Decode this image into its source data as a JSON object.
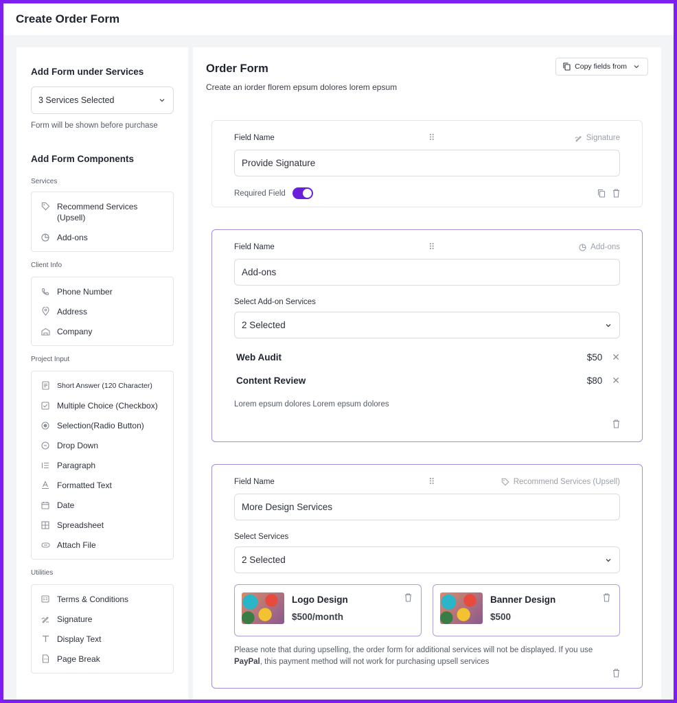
{
  "page": {
    "title": "Create Order Form"
  },
  "sidebar": {
    "add_form_title": "Add Form under Services",
    "services_select": "3 Services Selected",
    "services_hint": "Form will be shown before purchase",
    "components_title": "Add Form Components",
    "sections": [
      {
        "label": "Services",
        "items": [
          {
            "label": "Recommend Services (Upsell)",
            "icon": "tag-icon"
          },
          {
            "label": "Add-ons",
            "icon": "addons-icon"
          }
        ]
      },
      {
        "label": "Client Info",
        "items": [
          {
            "label": "Phone Number",
            "icon": "phone-icon"
          },
          {
            "label": "Address",
            "icon": "location-pin-icon"
          },
          {
            "label": "Company",
            "icon": "building-icon"
          }
        ]
      },
      {
        "label": "Project Input",
        "items": [
          {
            "label": "Short Answer (120 Character)",
            "icon": "short-answer-icon"
          },
          {
            "label": "Multiple Choice (Checkbox)",
            "icon": "checkbox-icon"
          },
          {
            "label": "Selection(Radio Button)",
            "icon": "radio-icon"
          },
          {
            "label": "Drop Down",
            "icon": "dropdown-icon"
          },
          {
            "label": "Paragraph",
            "icon": "paragraph-icon"
          },
          {
            "label": "Formatted Text",
            "icon": "formatted-text-icon"
          },
          {
            "label": "Date",
            "icon": "calendar-icon"
          },
          {
            "label": "Spreadsheet",
            "icon": "grid-icon"
          },
          {
            "label": "Attach File",
            "icon": "paperclip-icon"
          }
        ]
      },
      {
        "label": "Utilities",
        "items": [
          {
            "label": "Terms & Conditions",
            "icon": "terms-icon"
          },
          {
            "label": "Signature",
            "icon": "signature-icon"
          },
          {
            "label": "Display Text",
            "icon": "text-icon"
          },
          {
            "label": "Page Break",
            "icon": "page-break-icon"
          }
        ]
      }
    ]
  },
  "main": {
    "title": "Order Form",
    "subtitle": "Create an iorder  florem epsum dolores lorem epsum",
    "copy_button": "Copy fields from",
    "cards": {
      "signature": {
        "field_label": "Field Name",
        "type": "Signature",
        "value": "Provide Signature",
        "required_label": "Required Field",
        "required": true
      },
      "addons": {
        "field_label": "Field Name",
        "type": "Add-ons",
        "value": "Add-ons",
        "select_label": "Select Add-on Services",
        "select_value": "2 Selected",
        "items": [
          {
            "name": "Web Audit",
            "price": "$50"
          },
          {
            "name": "Content Review",
            "price": "$80"
          }
        ],
        "note": "Lorem epsum dolores Lorem epsum dolores"
      },
      "upsell": {
        "field_label": "Field Name",
        "type": "Recommend Services (Upsell)",
        "value": "More Design Services",
        "select_label": "Select Services",
        "select_value": "2 Selected",
        "services": [
          {
            "name": "Logo Design",
            "price": "$500/month"
          },
          {
            "name": "Banner Design",
            "price": "$500"
          }
        ],
        "note_before": "Please note that during upselling, the order form for additional services will not be displayed. If you use ",
        "note_bold": "PayPal",
        "note_after": ", this payment method will not work for purchasing upsell services"
      }
    }
  },
  "colors": {
    "accent": "#6a1fd8",
    "frame": "#7c1ff0",
    "active_border": "#a78bdb"
  }
}
